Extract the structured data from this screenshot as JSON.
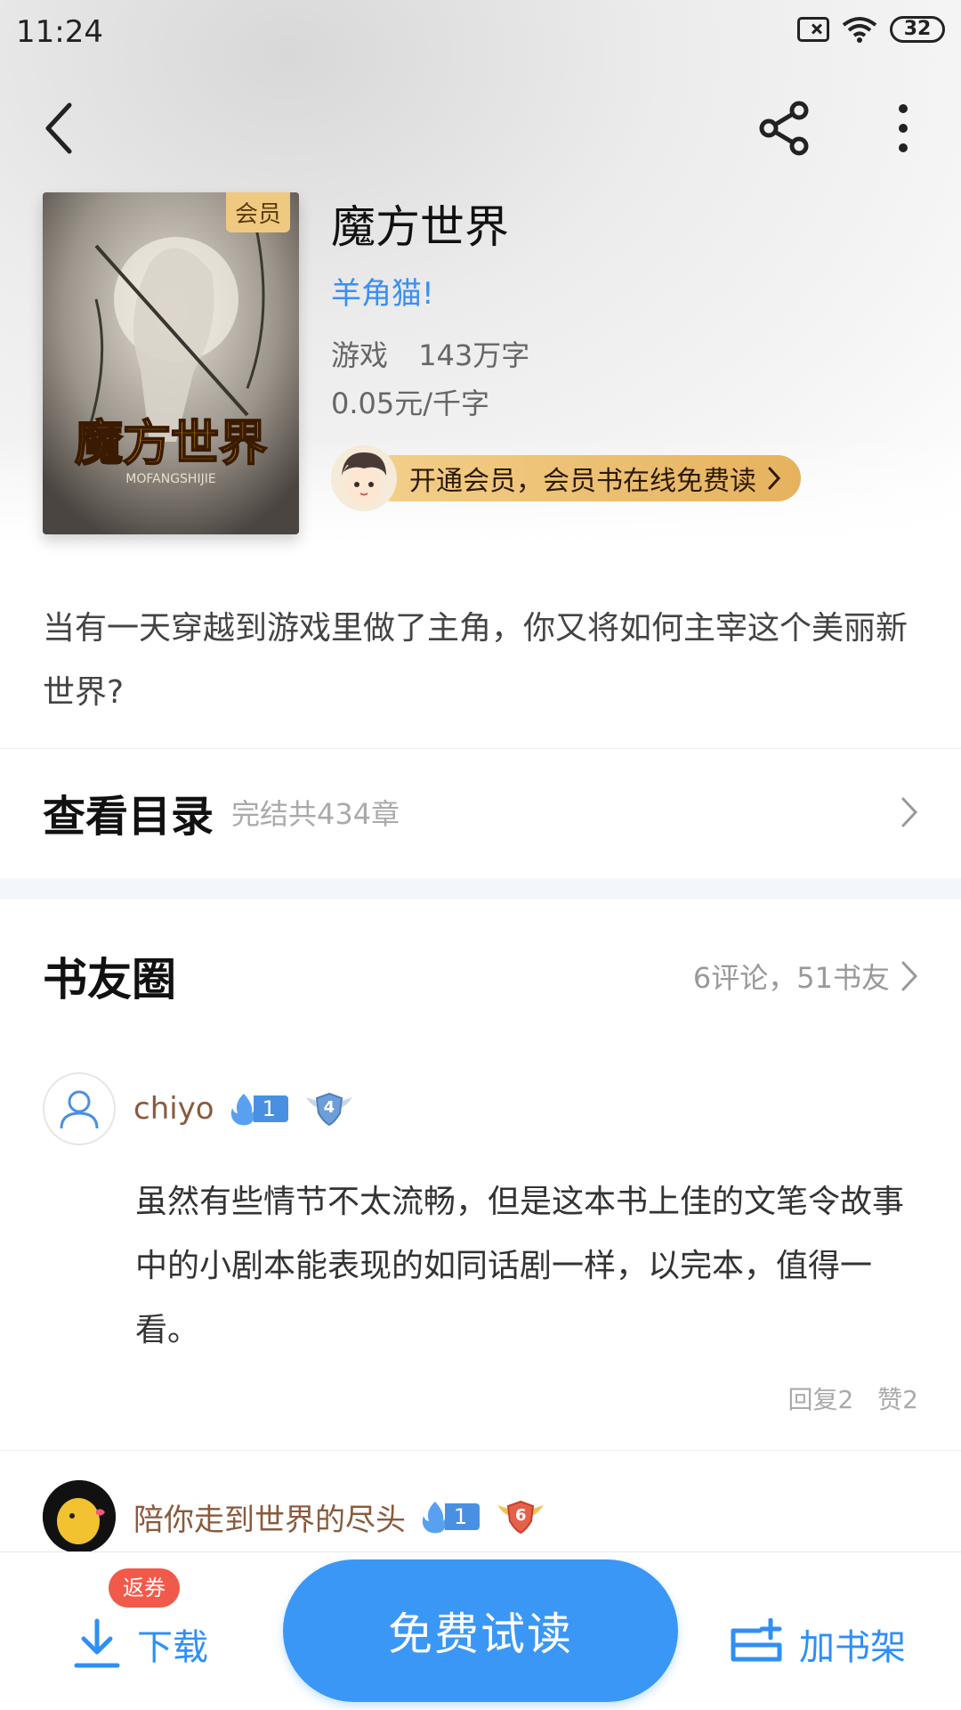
{
  "status_bar": {
    "time": "11:24",
    "battery": "32"
  },
  "book": {
    "title": "魔方世界",
    "author": "羊角猫!",
    "category": "游戏",
    "word_count": "143万字",
    "price": "0.05元/千字",
    "member_tag": "会员",
    "cover_title": "魔方世界",
    "cover_subtitle": "MOFANGSHIJIE"
  },
  "vip_banner": {
    "label": "开通会员，会员书在线免费读"
  },
  "description": "当有一天穿越到游戏里做了主角，你又将如何主宰这个美丽新世界?",
  "toc": {
    "title": "查看目录",
    "subtitle": "完结共434章"
  },
  "circle": {
    "title": "书友圈",
    "stats": "6评论，51书友"
  },
  "comments": [
    {
      "user": "chiyo",
      "fire_level": "1",
      "badge_level": "4",
      "text": "虽然有些情节不太流畅，但是这本书上佳的文笔令故事中的小剧本能表现的如同话剧一样，以完本，值得一看。",
      "replies": "回复2",
      "likes": "赞2"
    },
    {
      "user": "陪你走到世界的尽头",
      "fire_level": "1",
      "badge_level": "6"
    }
  ],
  "bottom_bar": {
    "download_label": "下载",
    "coupon_badge": "返券",
    "read_label": "免费试读",
    "shelf_label": "加书架"
  },
  "colors": {
    "accent": "#3a97f5",
    "author": "#3b8ff0",
    "username": "#8a5a3c",
    "vip_gold": "#e6b25e",
    "coupon": "#f15a4a"
  }
}
